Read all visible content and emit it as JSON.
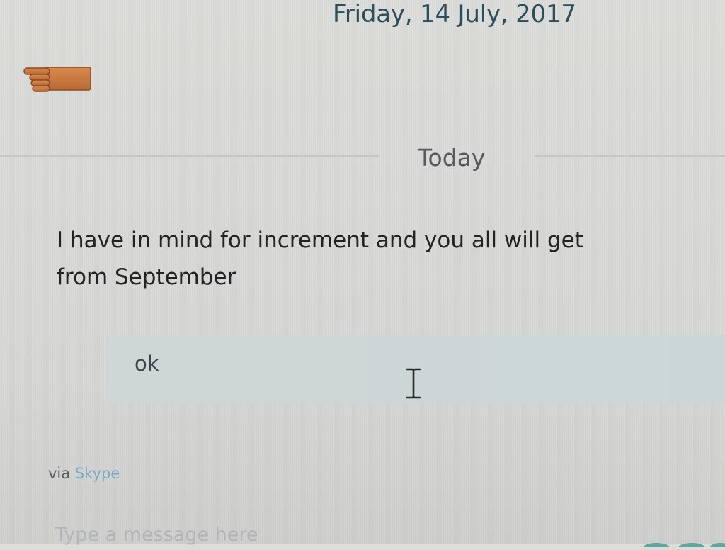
{
  "conversation": {
    "date_header": "Friday, 14 July, 2017",
    "emoji_message": {
      "icon": "backhand-index-pointing-left-emoji"
    },
    "day_divider": "Today",
    "incoming_message": {
      "line1": "I have in mind for increment and you all will get",
      "line2": "from September"
    },
    "outgoing_message": {
      "text": "ok"
    },
    "footer": {
      "via_prefix": "via",
      "via_link": "Skype"
    }
  },
  "composer": {
    "placeholder": "Type a message here"
  },
  "colors": {
    "date_text": "#2b4e5d",
    "link": "#7da9c4",
    "outgoing_bubble": "#cbd7d7"
  }
}
